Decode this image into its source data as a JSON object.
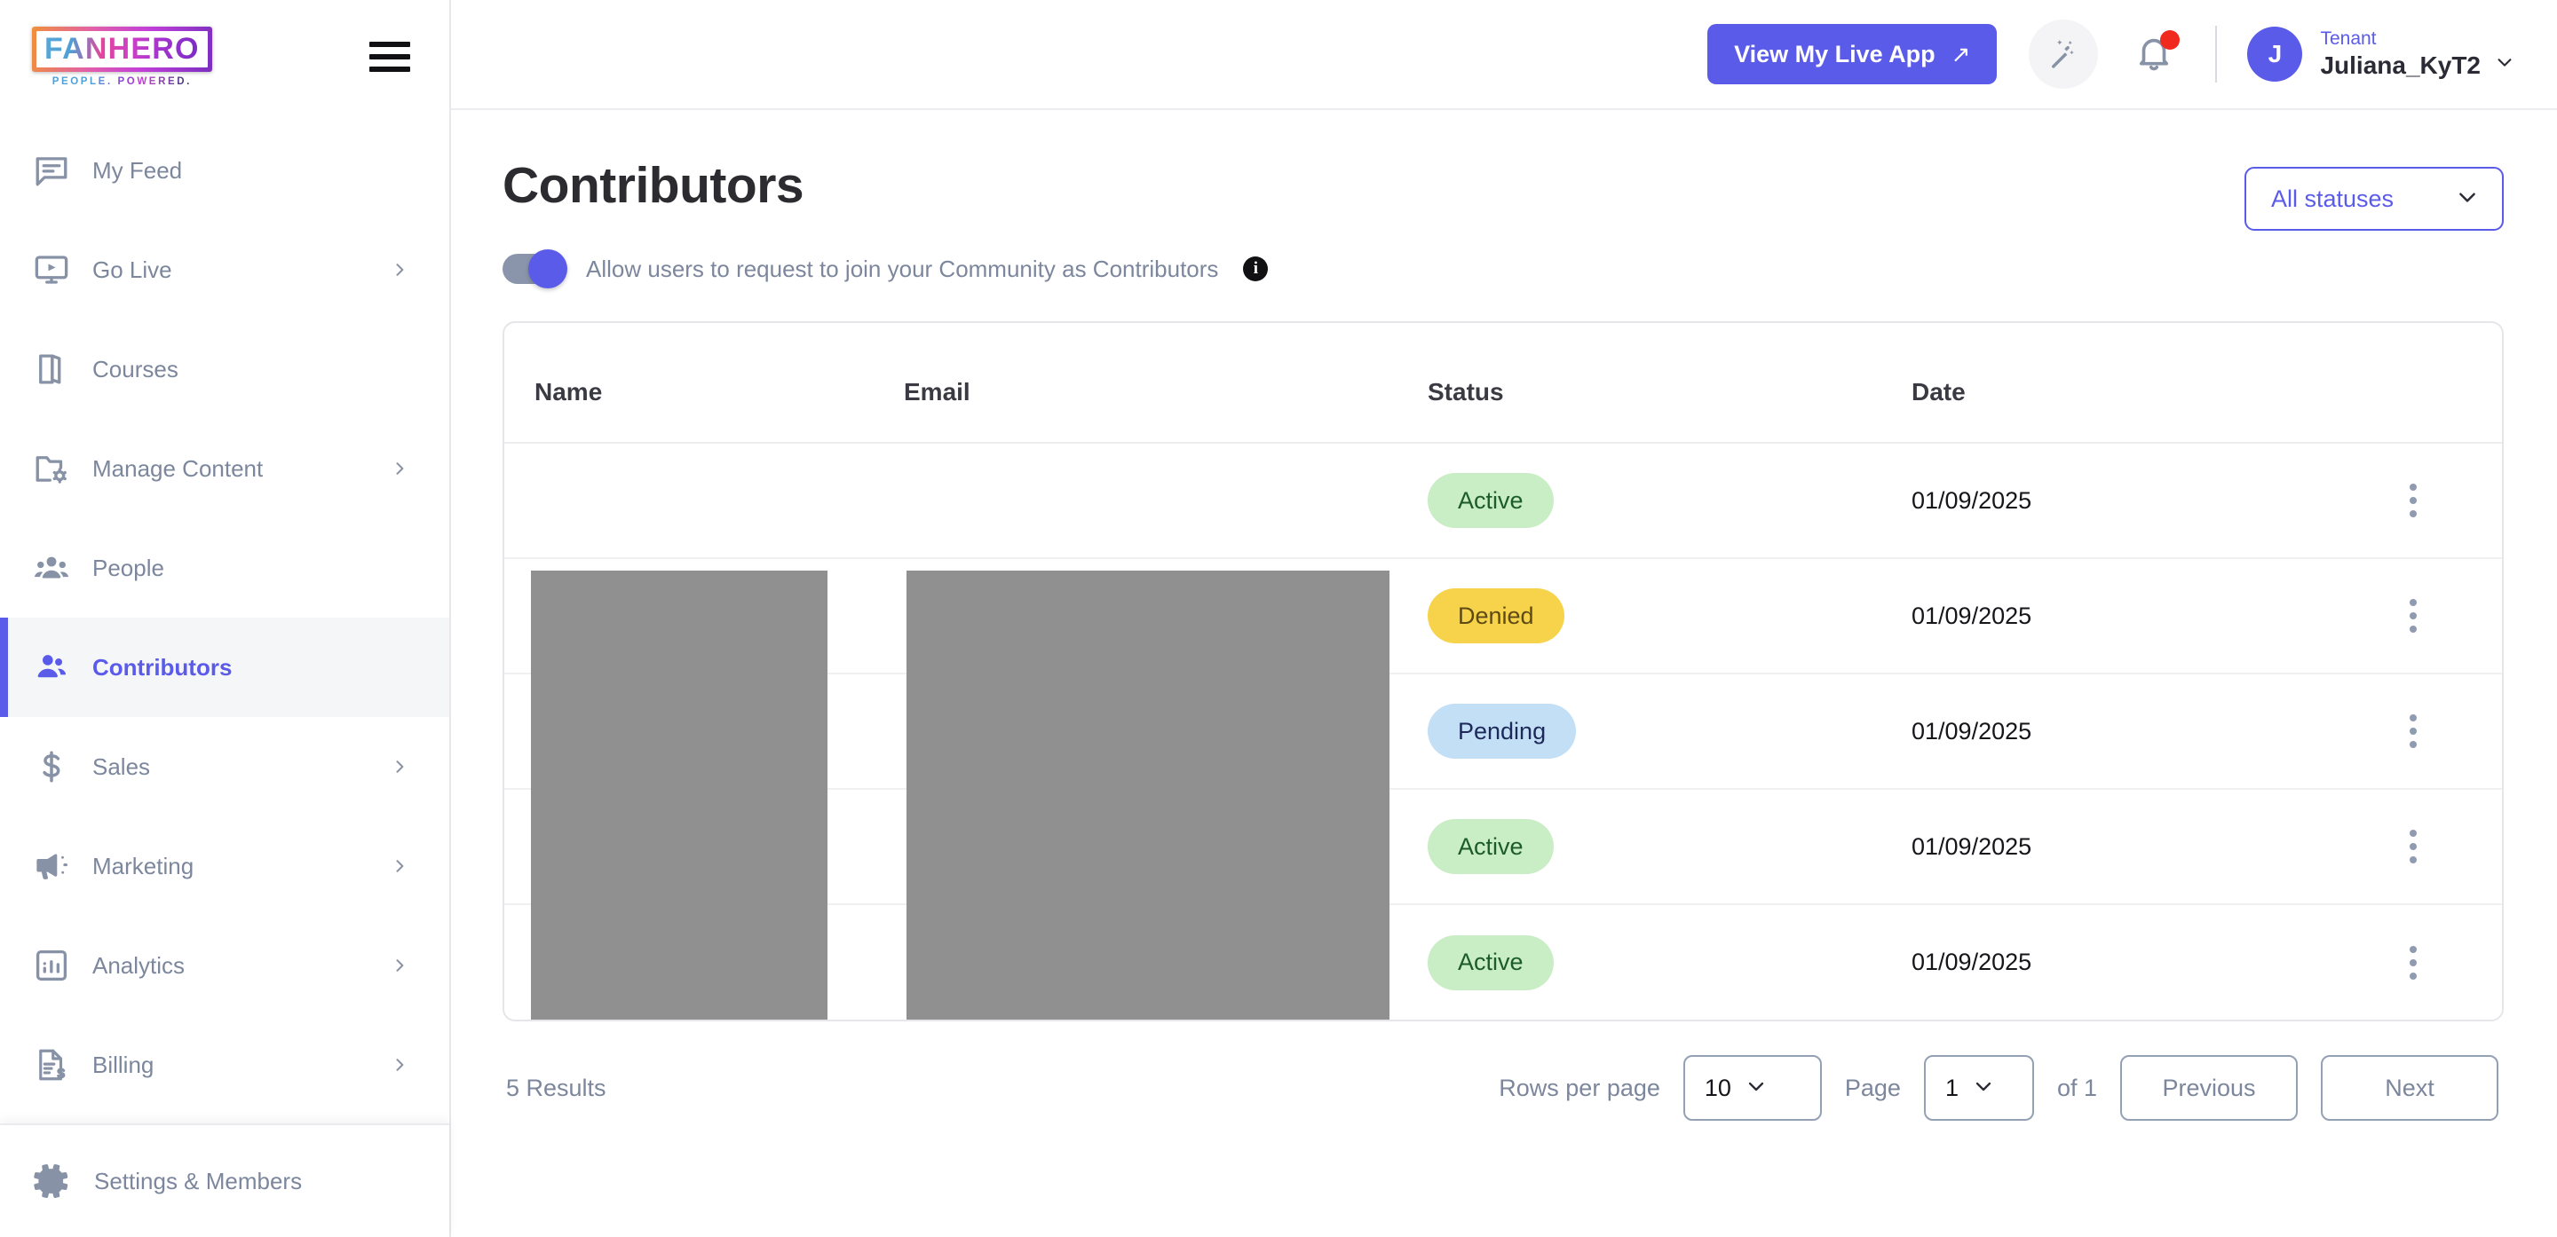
{
  "brand": {
    "logo_text": "FANHERO",
    "logo_tagline": "PEOPLE. POWERED.",
    "accent_color": "#5b5bea"
  },
  "sidebar": {
    "items": [
      {
        "label": "My Feed",
        "icon": "feed-icon",
        "has_chevron": false,
        "active": false
      },
      {
        "label": "Go Live",
        "icon": "broadcast-icon",
        "has_chevron": true,
        "active": false
      },
      {
        "label": "Courses",
        "icon": "book-icon",
        "has_chevron": false,
        "active": false
      },
      {
        "label": "Manage Content",
        "icon": "folder-gear-icon",
        "has_chevron": true,
        "active": false
      },
      {
        "label": "People",
        "icon": "people-icon",
        "has_chevron": false,
        "active": false
      },
      {
        "label": "Contributors",
        "icon": "contributors-icon",
        "has_chevron": false,
        "active": true
      },
      {
        "label": "Sales",
        "icon": "dollar-icon",
        "has_chevron": true,
        "active": false
      },
      {
        "label": "Marketing",
        "icon": "megaphone-icon",
        "has_chevron": true,
        "active": false
      },
      {
        "label": "Analytics",
        "icon": "analytics-icon",
        "has_chevron": true,
        "active": false
      },
      {
        "label": "Billing",
        "icon": "billing-icon",
        "has_chevron": true,
        "active": false
      }
    ],
    "footer": {
      "label": "Settings & Members",
      "icon": "gear-icon"
    }
  },
  "topbar": {
    "live_app_label": "View My Live App",
    "live_app_arrow": "↗",
    "wand_icon": "magic-wand-icon",
    "bell_icon": "bell-icon",
    "has_notification": true,
    "user": {
      "avatar_initial": "J",
      "role_label": "Tenant",
      "name": "Juliana_KyT2",
      "chevron": "chevron-down-icon"
    }
  },
  "page": {
    "title": "Contributors",
    "status_filter": {
      "value": "All statuses"
    },
    "toggle": {
      "label": "Allow users to request to join your Community as Contributors",
      "enabled": true,
      "info_glyph": "i"
    }
  },
  "table": {
    "columns": [
      "Name",
      "Email",
      "Status",
      "Date"
    ],
    "rows": [
      {
        "name": "",
        "email": "",
        "status": "Active",
        "status_kind": "active",
        "date": "01/09/2025"
      },
      {
        "name": "",
        "email": "",
        "status": "Denied",
        "status_kind": "denied",
        "date": "01/09/2025"
      },
      {
        "name": "",
        "email": "",
        "status": "Pending",
        "status_kind": "pending",
        "date": "01/09/2025"
      },
      {
        "name": "",
        "email": "",
        "status": "Active",
        "status_kind": "active",
        "date": "01/09/2025"
      },
      {
        "name": "",
        "email": "",
        "status": "Active",
        "status_kind": "active",
        "date": "01/09/2025"
      }
    ],
    "redacted_columns": [
      "Name",
      "Email"
    ]
  },
  "pagination": {
    "results_label": "5 Results",
    "rows_per_page_label": "Rows per page",
    "rows_per_page_value": "10",
    "page_label": "Page",
    "page_value": "1",
    "of_label": "of 1",
    "previous_label": "Previous",
    "next_label": "Next"
  },
  "status_colors": {
    "active_bg": "#c9edc4",
    "active_fg": "#1d5b2a",
    "denied_bg": "#f6d34b",
    "denied_fg": "#5d4a15",
    "pending_bg": "#c3dff6",
    "pending_fg": "#1d2a59"
  }
}
